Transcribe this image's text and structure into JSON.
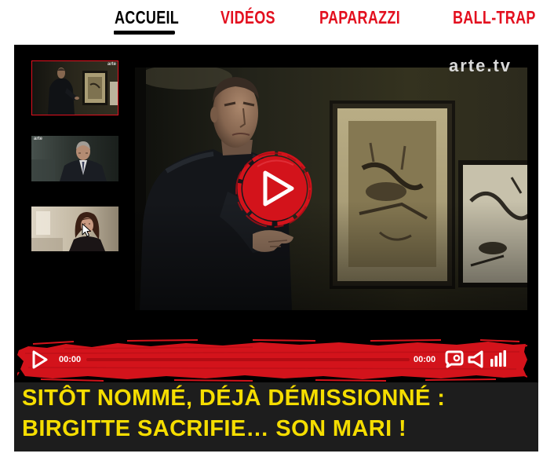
{
  "nav": {
    "items": [
      {
        "label": "ACCUEIL",
        "active": true
      },
      {
        "label": "VIDÉOS",
        "active": false
      },
      {
        "label": "PAPARAZZI",
        "active": false
      },
      {
        "label": "BALL-TRAP",
        "active": false
      }
    ]
  },
  "player": {
    "watermark": "arte.tv",
    "playlist": [
      {
        "watermark": "arte",
        "selected": true
      },
      {
        "watermark": "arte",
        "selected": false
      },
      {
        "selected": false
      }
    ],
    "big_play_icon": "play-icon",
    "controls": {
      "play_icon": "play-icon",
      "current_time": "00:00",
      "progress": 0,
      "duration": "00:00",
      "screen_icon": "screen-icon",
      "volume_icon": "speaker-icon",
      "volume_level_icon": "volume-bars-icon"
    }
  },
  "article": {
    "title_line1": "SITÔT NOMMÉ, DÉJÀ DÉMISSIONNÉ :",
    "title_line2": "BIRGITTE SACRIFIE… SON MARI !"
  },
  "colors": {
    "nav_link": "#e3101f",
    "nav_active": "#000000",
    "title_text": "#f5dd00",
    "controls": "#d3131b"
  }
}
